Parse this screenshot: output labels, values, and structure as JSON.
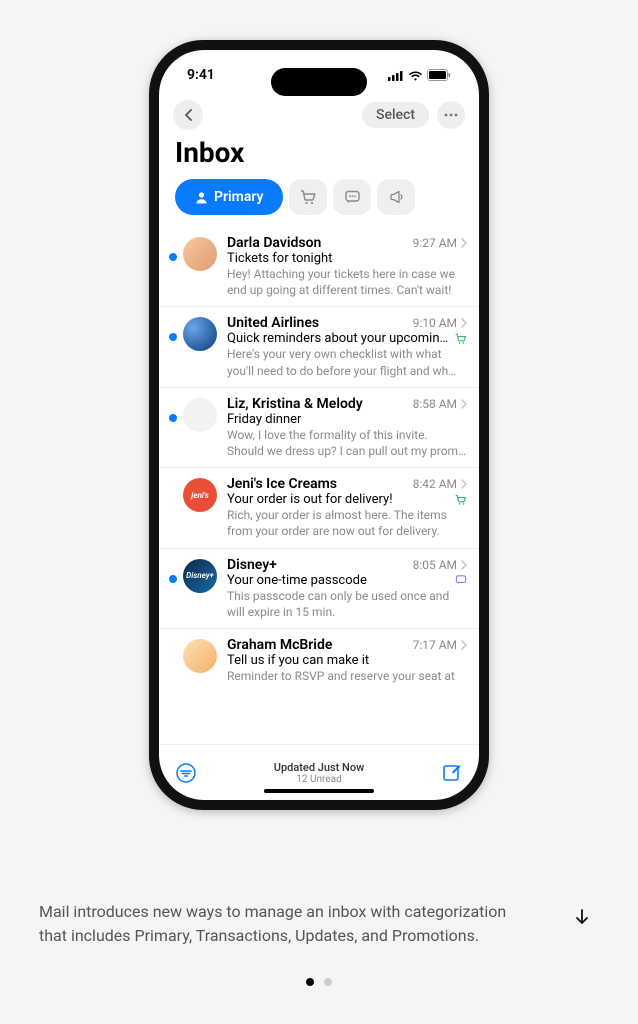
{
  "status": {
    "time": "9:41"
  },
  "nav": {
    "select_label": "Select"
  },
  "title": "Inbox",
  "tabs": {
    "primary_label": "Primary"
  },
  "emails": [
    {
      "unread": true,
      "avatar_bg": "linear-gradient(135deg,#f6c89f,#e29a72)",
      "avatar_text": "",
      "sender": "Darla Davidson",
      "time": "9:27 AM",
      "subject": "Tickets for tonight",
      "category": "",
      "preview": "Hey! Attaching your tickets here in case we end up going at different times. Can't wait!"
    },
    {
      "unread": true,
      "avatar_bg": "radial-gradient(circle at 30% 30%, #6aa7e8, #0b3a7a)",
      "avatar_text": "",
      "sender": "United Airlines",
      "time": "9:10 AM",
      "subject": "Quick reminders about your upcoming…",
      "category": "transactions",
      "preview": "Here's your very own checklist with what you'll need to do before your flight and wh…"
    },
    {
      "unread": true,
      "avatar_bg": "#f2f2f2",
      "avatar_text": "",
      "sender": "Liz, Kristina & Melody",
      "time": "8:58 AM",
      "subject": "Friday dinner",
      "category": "",
      "preview": "Wow, I love the formality of this invite. Should we dress up? I can pull out my prom dress…"
    },
    {
      "unread": false,
      "avatar_bg": "#e94f37",
      "avatar_text": "jeni's",
      "sender": "Jeni's Ice Creams",
      "time": "8:42 AM",
      "subject": "Your order is out for delivery!",
      "category": "transactions",
      "preview": "Rich, your order is almost here. The items from your order are now out for delivery."
    },
    {
      "unread": true,
      "avatar_bg": "linear-gradient(135deg,#0b2a4a,#1b6aa8)",
      "avatar_text": "Disney+",
      "sender": "Disney+",
      "time": "8:05 AM",
      "subject": "Your one-time passcode",
      "category": "updates",
      "preview": "This passcode can only be used once and will expire in 15 min."
    },
    {
      "unread": false,
      "avatar_bg": "linear-gradient(135deg,#ffe0b2,#f5b06a)",
      "avatar_text": "",
      "sender": "Graham McBride",
      "time": "7:17 AM",
      "subject": "Tell us if you can make it",
      "category": "",
      "preview": "Reminder to RSVP and reserve your seat at"
    }
  ],
  "bottom": {
    "updated": "Updated Just Now",
    "unread": "12 Unread"
  },
  "caption": "Mail introduces new ways to manage an inbox with categorization that includes Primary, Transactions, Updates, and Promotions."
}
